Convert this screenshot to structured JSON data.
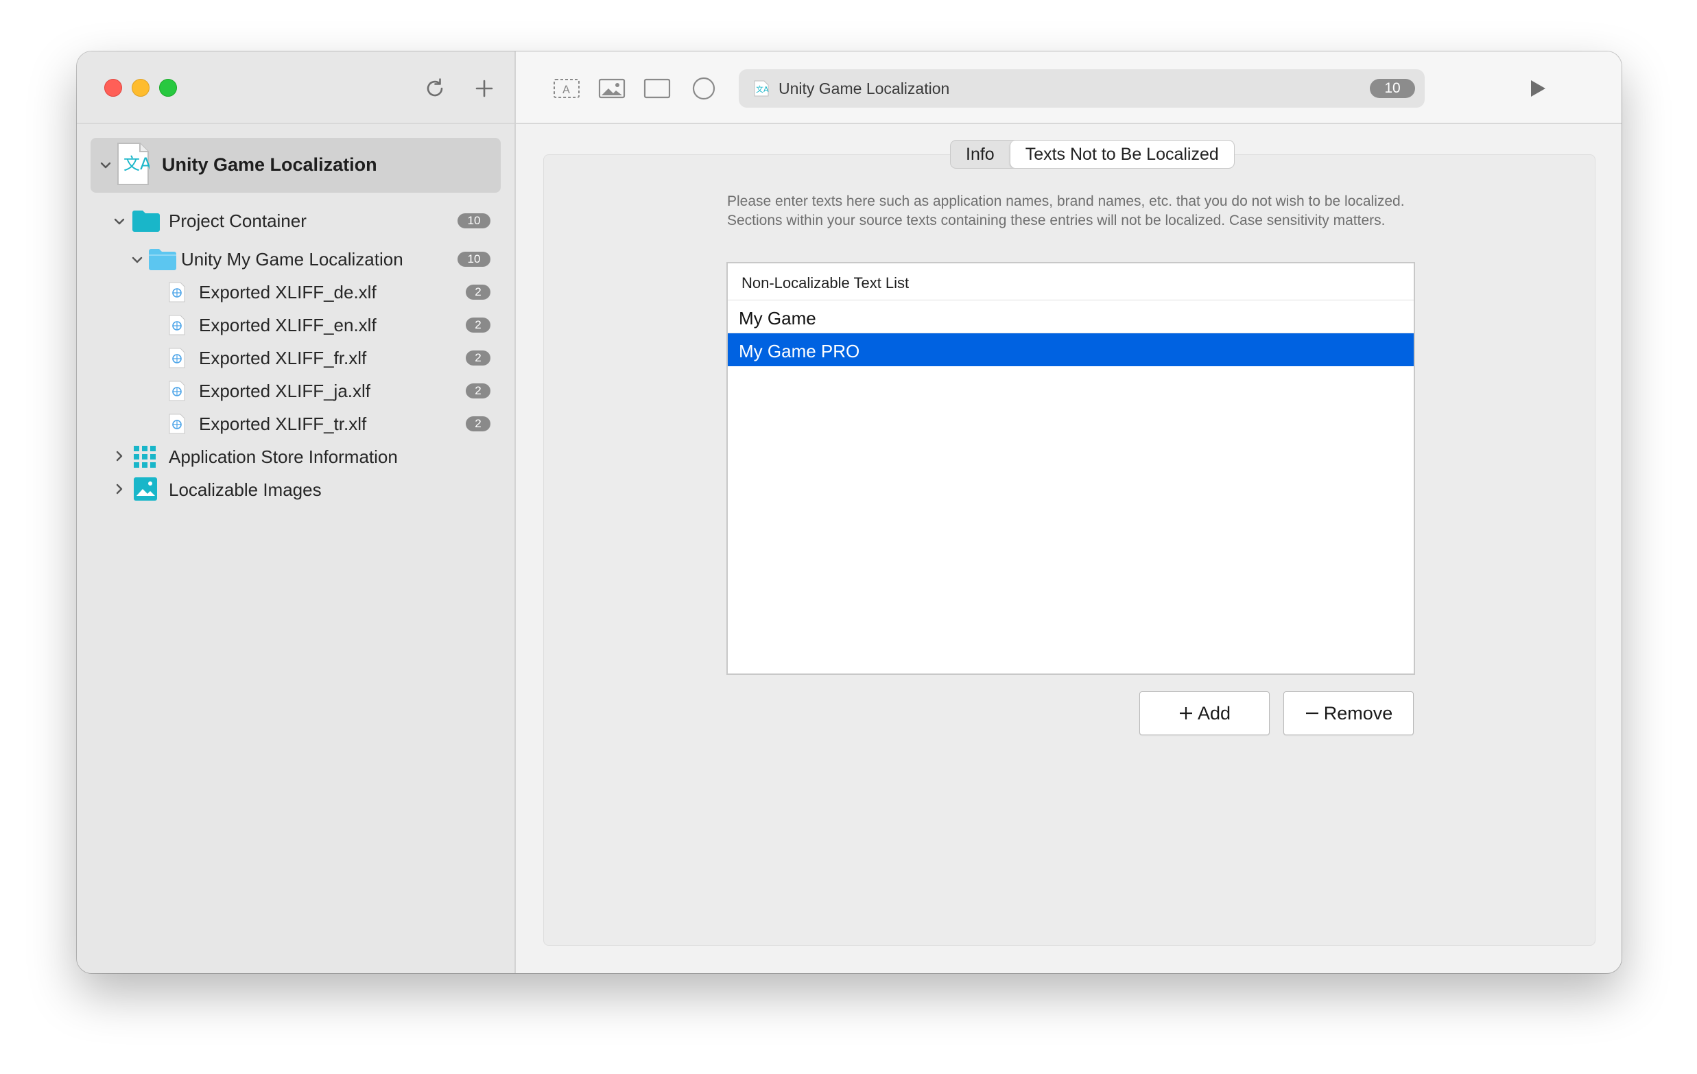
{
  "window": {
    "title": "Unity Game Localization",
    "badge": "10"
  },
  "toolbar": {
    "icons": [
      "refresh-icon",
      "plus-icon",
      "text-frame-icon",
      "image-icon",
      "rectangle-icon",
      "circle-icon",
      "play-icon",
      "info-icon"
    ]
  },
  "sidebar": {
    "root": {
      "label": "Unity Game Localization"
    },
    "items": [
      {
        "label": "Project Container",
        "badge": "10"
      },
      {
        "label": "Unity My Game Localization",
        "badge": "10"
      },
      {
        "label": "Exported XLIFF_de.xlf",
        "badge": "2"
      },
      {
        "label": "Exported XLIFF_en.xlf",
        "badge": "2"
      },
      {
        "label": "Exported XLIFF_fr.xlf",
        "badge": "2"
      },
      {
        "label": "Exported XLIFF_ja.xlf",
        "badge": "2"
      },
      {
        "label": "Exported XLIFF_tr.xlf",
        "badge": "2"
      },
      {
        "label": "Application Store Information"
      },
      {
        "label": "Localizable Images"
      }
    ]
  },
  "tabs": [
    {
      "label": "Info",
      "active": false
    },
    {
      "label": "Texts Not to Be Localized",
      "active": true
    }
  ],
  "content": {
    "description": "Please enter texts here such as application names, brand names, etc. that you do not wish to be localized. Sections within your source texts containing these entries will not be localized. Case sensitivity matters.",
    "list_header": "Non-Localizable Text List",
    "rows": [
      {
        "text": "My Game",
        "selected": false
      },
      {
        "text": "My Game PRO",
        "selected": true
      }
    ],
    "add_label": "Add",
    "remove_label": "Remove"
  },
  "colors": {
    "accent": "#0062e1",
    "folder": "#19b6c9",
    "folder_light": "#5cc6f0"
  }
}
